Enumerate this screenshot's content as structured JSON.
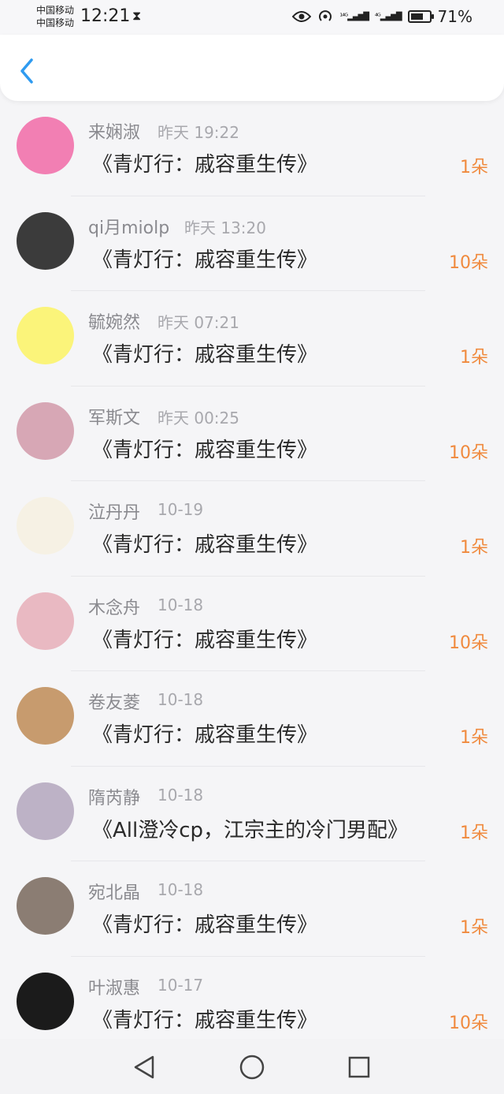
{
  "status_bar": {
    "carrier1": "中国移动",
    "carrier2": "中国移动",
    "time": "12:21",
    "net1": "¹⁴ᴳ",
    "net2": "⁴ᴳ",
    "battery_percent": "71%",
    "battery_level": 0.71
  },
  "items": [
    {
      "name": "来娴淑",
      "time": "昨天 19:22",
      "title": "《青灯行：戚容重生传》",
      "count": "1朵",
      "avatar_color": "#f27fb3"
    },
    {
      "name": "qi月miolp",
      "time": "昨天 13:20",
      "title": "《青灯行：戚容重生传》",
      "count": "10朵",
      "avatar_color": "#3b3b3b"
    },
    {
      "name": "毓婉然",
      "time": "昨天 07:21",
      "title": "《青灯行：戚容重生传》",
      "count": "1朵",
      "avatar_color": "#fbf47a"
    },
    {
      "name": "军斯文",
      "time": "昨天 00:25",
      "title": "《青灯行：戚容重生传》",
      "count": "10朵",
      "avatar_color": "#d7a7b5"
    },
    {
      "name": "泣丹丹",
      "time": "10-19",
      "title": "《青灯行：戚容重生传》",
      "count": "1朵",
      "avatar_color": "#f6f1e4"
    },
    {
      "name": "木念舟",
      "time": "10-18",
      "title": "《青灯行：戚容重生传》",
      "count": "10朵",
      "avatar_color": "#e9b9c2"
    },
    {
      "name": "卷友菱",
      "time": "10-18",
      "title": "《青灯行：戚容重生传》",
      "count": "1朵",
      "avatar_color": "#c79b6e"
    },
    {
      "name": "隋芮静",
      "time": "10-18",
      "title": "《All澄冷cp，江宗主的冷门男配》",
      "count": "1朵",
      "avatar_color": "#bdb2c6"
    },
    {
      "name": "宛北晶",
      "time": "10-18",
      "title": "《青灯行：戚容重生传》",
      "count": "1朵",
      "avatar_color": "#8b7d73"
    },
    {
      "name": "叶淑惠",
      "time": "10-17",
      "title": "《青灯行：戚容重生传》",
      "count": "10朵",
      "avatar_color": "#1b1b1b"
    }
  ],
  "colors": {
    "accent_back": "#2f9bf0",
    "count": "#f08a3e",
    "name": "#8a8a8f",
    "time": "#a8a8ad",
    "title": "#2a2a2a"
  },
  "icons": {
    "back": "chevron-left-icon",
    "eye": "eye-icon",
    "hotspot": "hotspot-icon",
    "hourglass": "hourglass-icon",
    "nav_back": "triangle-back-icon",
    "nav_home": "circle-home-icon",
    "nav_recent": "square-recent-icon"
  }
}
